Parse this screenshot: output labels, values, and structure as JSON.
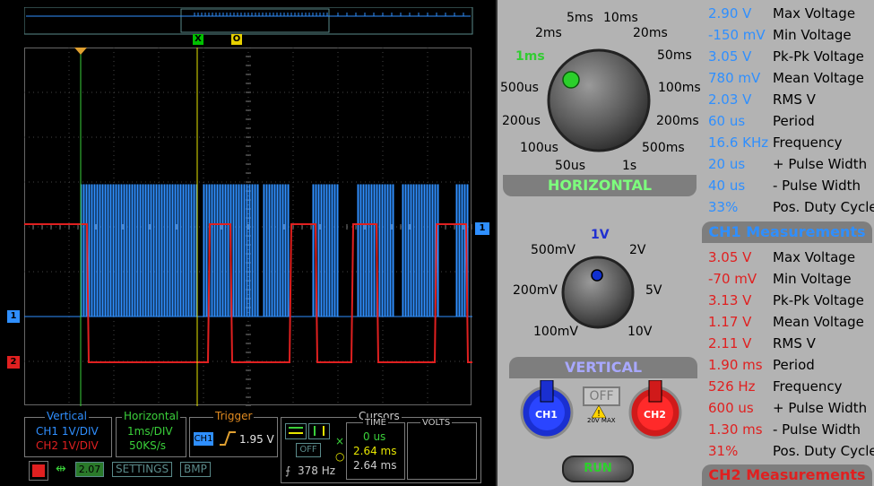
{
  "channels": {
    "ch1_color": "#2f8fff",
    "ch2_color": "#e02020",
    "ch1_marker": "1",
    "ch2_marker": "2"
  },
  "status": {
    "vertical_title": "Vertical",
    "ch1_scale": "CH1 1V/DIV",
    "ch2_scale": "CH2 1V/DIV",
    "horizontal_title": "Horizontal",
    "time_div": "1ms/DIV",
    "sample_rate": "50KS/s",
    "trigger_title": "Trigger",
    "trigger_channel": "CH1",
    "trigger_level": "1.95 V",
    "cursors_title": "Cursors",
    "time_title": "TIME",
    "volts_title": "VOLTS",
    "cursor_off": "OFF",
    "cursor_x_time": "0 us",
    "cursor_o_time": "2.64 ms",
    "cursor_delta_time": "2.64 ms",
    "cursor_freq": "378 Hz",
    "usb_version": "2.07",
    "settings_button": "SETTINGS",
    "bmp_button": "BMP",
    "cursor_x_marker": "X",
    "cursor_o_marker": "O"
  },
  "horizontal": {
    "title": "HORIZONTAL",
    "selected": "1ms",
    "labels": [
      "5ms",
      "10ms",
      "2ms",
      "20ms",
      "1ms",
      "50ms",
      "500us",
      "100ms",
      "200us",
      "200ms",
      "100us",
      "500ms",
      "50us",
      "1s"
    ]
  },
  "vertical": {
    "title": "VERTICAL",
    "selected": "1V",
    "labels": [
      "1V",
      "500mV",
      "2V",
      "200mV",
      "5V",
      "100mV",
      "10V"
    ]
  },
  "controls": {
    "ch1_button": "CH1",
    "ch2_button": "CH2",
    "off_button": "OFF",
    "max_warning": "20V MAX",
    "run_button": "RUN"
  },
  "ch1_measurements": {
    "title": "CH1 Measurements",
    "color": "#2f8fff",
    "rows": [
      {
        "value": "2.90 V",
        "name": "Max Voltage"
      },
      {
        "value": "-150 mV",
        "name": "Min Voltage"
      },
      {
        "value": "3.05 V",
        "name": "Pk-Pk Voltage"
      },
      {
        "value": "780 mV",
        "name": "Mean Voltage"
      },
      {
        "value": "2.03 V",
        "name": "RMS V"
      },
      {
        "value": "60 us",
        "name": "Period"
      },
      {
        "value": "16.6 KHz",
        "name": "Frequency"
      },
      {
        "value": "20 us",
        "name": "+ Pulse Width"
      },
      {
        "value": "40 us",
        "name": "- Pulse Width"
      },
      {
        "value": "33%",
        "name": "Pos. Duty Cycle"
      }
    ]
  },
  "ch2_measurements": {
    "title": "CH2 Measurements",
    "color": "#e02020",
    "rows": [
      {
        "value": "3.05 V",
        "name": "Max Voltage"
      },
      {
        "value": "-70 mV",
        "name": "Min Voltage"
      },
      {
        "value": "3.13 V",
        "name": "Pk-Pk Voltage"
      },
      {
        "value": "1.17 V",
        "name": "Mean Voltage"
      },
      {
        "value": "2.11 V",
        "name": "RMS V"
      },
      {
        "value": "1.90 ms",
        "name": "Period"
      },
      {
        "value": "526 Hz",
        "name": "Frequency"
      },
      {
        "value": "600 us",
        "name": "+ Pulse Width"
      },
      {
        "value": "1.30 ms",
        "name": "- Pulse Width"
      },
      {
        "value": "31%",
        "name": "Pos. Duty Cycle"
      }
    ]
  }
}
